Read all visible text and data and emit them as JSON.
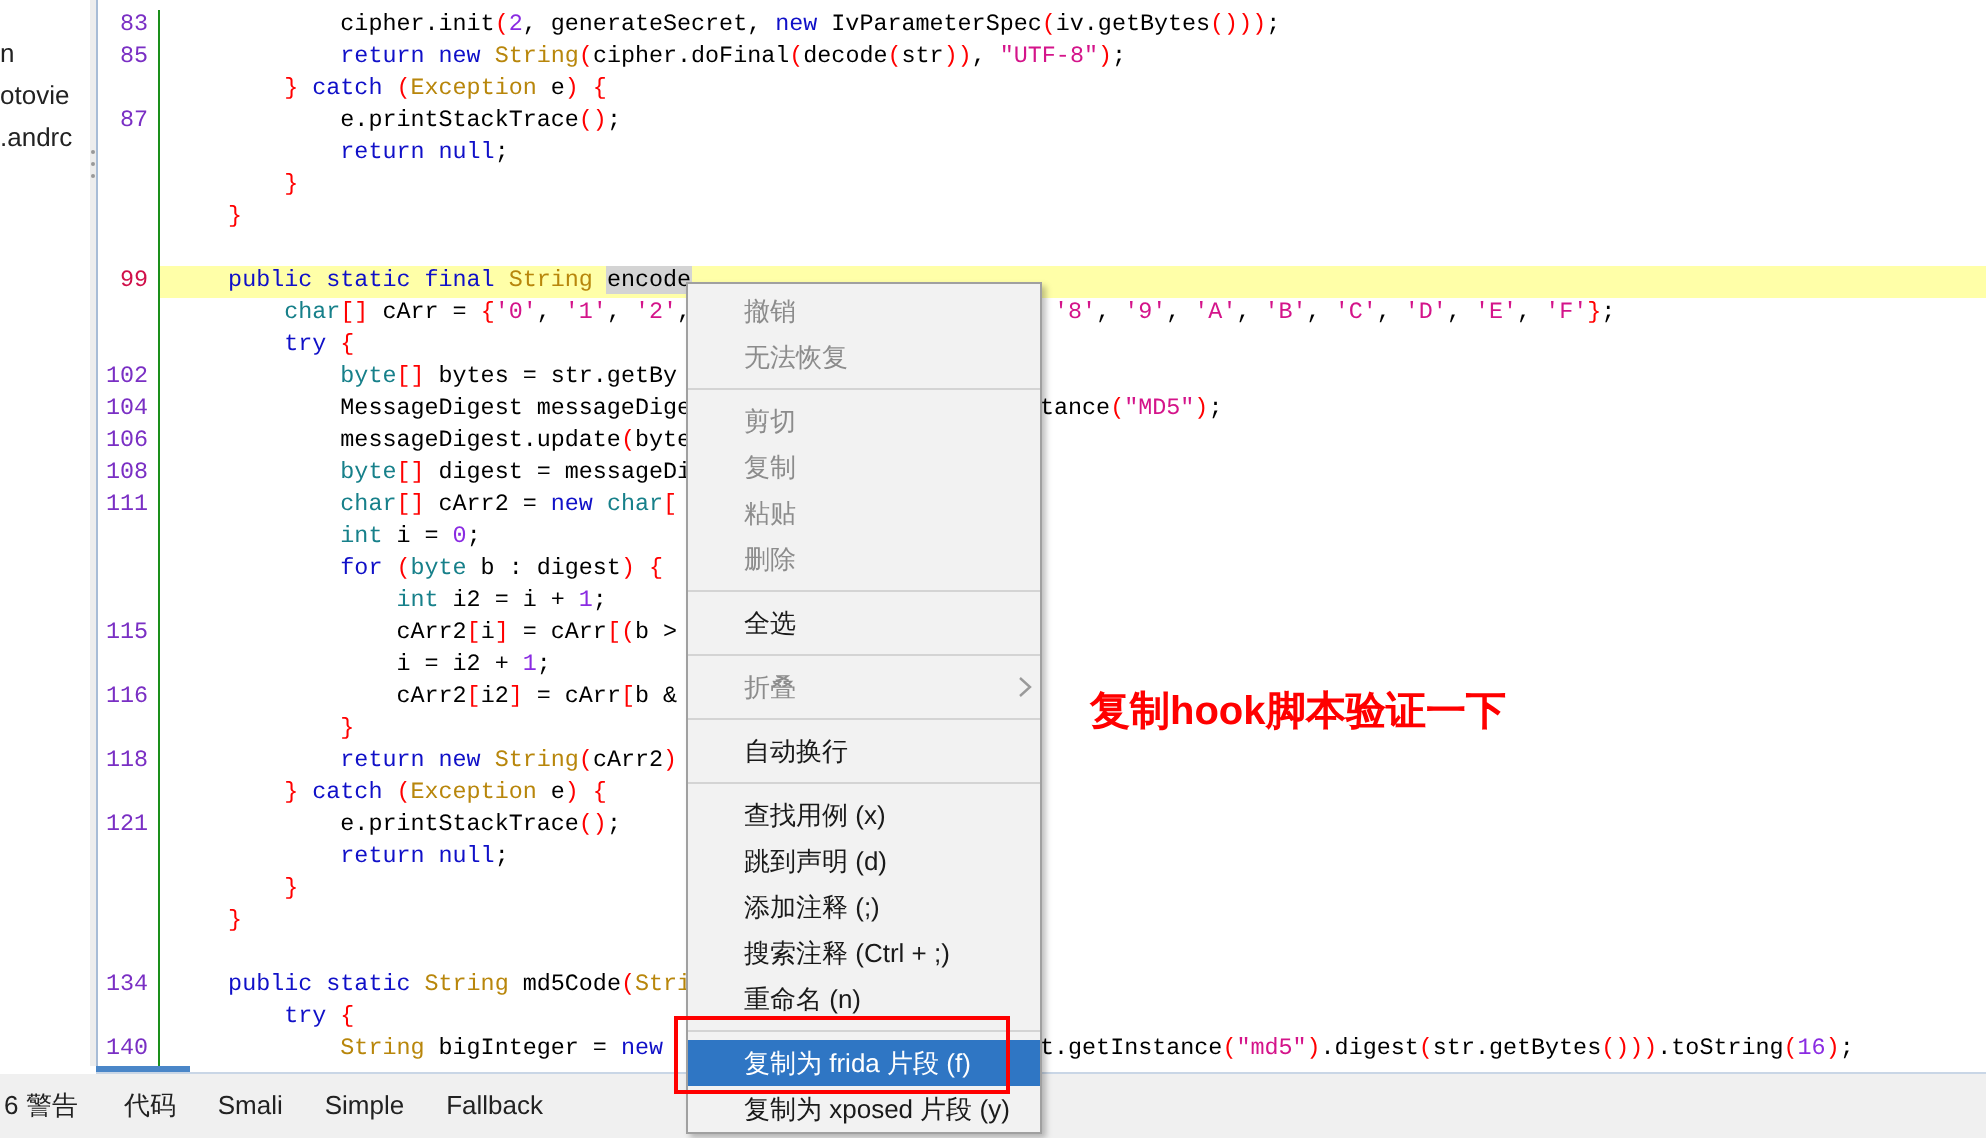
{
  "tree": {
    "items": [
      "n",
      "otovie",
      ".andrc"
    ]
  },
  "editor": {
    "lines": [
      {
        "number": "83",
        "selected": false,
        "tokens": [
          {
            "kind": "plain",
            "text": "            cipher.init"
          },
          {
            "kind": "br",
            "text": "("
          },
          {
            "kind": "num",
            "text": "2"
          },
          {
            "kind": "plain",
            "text": ", generateSecret, "
          },
          {
            "kind": "kw",
            "text": "new"
          },
          {
            "kind": "plain",
            "text": " IvParameterSpec"
          },
          {
            "kind": "br",
            "text": "("
          },
          {
            "kind": "plain",
            "text": "iv.getBytes"
          },
          {
            "kind": "br",
            "text": "()))"
          },
          {
            "kind": "plain",
            "text": ";"
          }
        ]
      },
      {
        "number": "85",
        "selected": false,
        "tokens": [
          {
            "kind": "kw",
            "text": "            return new "
          },
          {
            "kind": "type",
            "text": "String"
          },
          {
            "kind": "br",
            "text": "("
          },
          {
            "kind": "plain",
            "text": "cipher.doFinal"
          },
          {
            "kind": "br",
            "text": "("
          },
          {
            "kind": "plain",
            "text": "decode"
          },
          {
            "kind": "br",
            "text": "("
          },
          {
            "kind": "plain",
            "text": "str"
          },
          {
            "kind": "br",
            "text": "))"
          },
          {
            "kind": "plain",
            "text": ", "
          },
          {
            "kind": "str",
            "text": "\"UTF-8\""
          },
          {
            "kind": "br",
            "text": ")"
          },
          {
            "kind": "plain",
            "text": ";"
          }
        ]
      },
      {
        "selected": false,
        "tokens": [
          {
            "kind": "br",
            "text": "        } "
          },
          {
            "kind": "kw",
            "text": "catch "
          },
          {
            "kind": "br",
            "text": "("
          },
          {
            "kind": "type",
            "text": "Exception"
          },
          {
            "kind": "plain",
            "text": " e"
          },
          {
            "kind": "br",
            "text": ") {"
          }
        ]
      },
      {
        "number": "87",
        "selected": false,
        "tokens": [
          {
            "kind": "plain",
            "text": "            e.printStackTrace"
          },
          {
            "kind": "br",
            "text": "()"
          },
          {
            "kind": "plain",
            "text": ";"
          }
        ]
      },
      {
        "selected": false,
        "tokens": [
          {
            "kind": "kw",
            "text": "            return null"
          },
          {
            "kind": "plain",
            "text": ";"
          }
        ]
      },
      {
        "selected": false,
        "tokens": [
          {
            "kind": "br",
            "text": "        }"
          }
        ]
      },
      {
        "selected": false,
        "tokens": [
          {
            "kind": "br",
            "text": "    }"
          }
        ]
      },
      {
        "selected": false
      },
      {
        "number": "99",
        "selected": true,
        "tokens": [
          {
            "kind": "kw",
            "text": "    public static final "
          },
          {
            "kind": "type",
            "text": "String "
          },
          {
            "kind": "match",
            "text": "encode"
          }
        ]
      },
      {
        "selected": false,
        "tokens": [
          {
            "kind": "prim",
            "text": "        char"
          },
          {
            "kind": "br",
            "text": "[]"
          },
          {
            "kind": "plain",
            "text": " cArr = "
          },
          {
            "kind": "br",
            "text": "{"
          },
          {
            "kind": "str",
            "text": "'0'"
          },
          {
            "kind": "plain",
            "text": ", "
          },
          {
            "kind": "str",
            "text": "'1'"
          },
          {
            "kind": "plain",
            "text": ", "
          },
          {
            "kind": "str",
            "text": "'2'"
          },
          {
            "kind": "plain",
            "text": ","
          }
        ],
        "right": [
          {
            "kind": "str",
            "text": " '8'"
          },
          {
            "kind": "plain",
            "text": ", "
          },
          {
            "kind": "str",
            "text": "'9'"
          },
          {
            "kind": "plain",
            "text": ", "
          },
          {
            "kind": "str",
            "text": "'A'"
          },
          {
            "kind": "plain",
            "text": ", "
          },
          {
            "kind": "str",
            "text": "'B'"
          },
          {
            "kind": "plain",
            "text": ", "
          },
          {
            "kind": "str",
            "text": "'C'"
          },
          {
            "kind": "plain",
            "text": ", "
          },
          {
            "kind": "str",
            "text": "'D'"
          },
          {
            "kind": "plain",
            "text": ", "
          },
          {
            "kind": "str",
            "text": "'E'"
          },
          {
            "kind": "plain",
            "text": ", "
          },
          {
            "kind": "str",
            "text": "'F'"
          },
          {
            "kind": "br",
            "text": "}"
          },
          {
            "kind": "plain",
            "text": ";"
          }
        ]
      },
      {
        "selected": false,
        "tokens": [
          {
            "kind": "kw",
            "text": "        try "
          },
          {
            "kind": "br",
            "text": "{"
          }
        ]
      },
      {
        "number": "102",
        "selected": false,
        "tokens": [
          {
            "kind": "prim",
            "text": "            byte"
          },
          {
            "kind": "br",
            "text": "[]"
          },
          {
            "kind": "plain",
            "text": " bytes = str.getBy"
          }
        ]
      },
      {
        "number": "104",
        "selected": false,
        "tokens": [
          {
            "kind": "plain",
            "text": "            MessageDigest messageDige"
          }
        ],
        "right": [
          {
            "kind": "plain",
            "text": "tance"
          },
          {
            "kind": "br",
            "text": "("
          },
          {
            "kind": "str",
            "text": "\"MD5\""
          },
          {
            "kind": "br",
            "text": ")"
          },
          {
            "kind": "plain",
            "text": ";"
          }
        ]
      },
      {
        "number": "106",
        "selected": false,
        "tokens": [
          {
            "kind": "plain",
            "text": "            messageDigest.update"
          },
          {
            "kind": "br",
            "text": "("
          },
          {
            "kind": "plain",
            "text": "byte"
          }
        ]
      },
      {
        "number": "108",
        "selected": false,
        "tokens": [
          {
            "kind": "prim",
            "text": "            byte"
          },
          {
            "kind": "br",
            "text": "[]"
          },
          {
            "kind": "plain",
            "text": " digest = messageDi"
          }
        ]
      },
      {
        "number": "111",
        "selected": false,
        "tokens": [
          {
            "kind": "prim",
            "text": "            char"
          },
          {
            "kind": "br",
            "text": "[]"
          },
          {
            "kind": "plain",
            "text": " cArr2 = "
          },
          {
            "kind": "kw",
            "text": "new "
          },
          {
            "kind": "prim",
            "text": "char"
          },
          {
            "kind": "br",
            "text": "["
          }
        ]
      },
      {
        "selected": false,
        "tokens": [
          {
            "kind": "prim",
            "text": "            int"
          },
          {
            "kind": "plain",
            "text": " i = "
          },
          {
            "kind": "num",
            "text": "0"
          },
          {
            "kind": "plain",
            "text": ";"
          }
        ]
      },
      {
        "selected": false,
        "tokens": [
          {
            "kind": "kw",
            "text": "            for "
          },
          {
            "kind": "br",
            "text": "("
          },
          {
            "kind": "prim",
            "text": "byte"
          },
          {
            "kind": "plain",
            "text": " b : digest"
          },
          {
            "kind": "br",
            "text": ") {"
          }
        ]
      },
      {
        "selected": false,
        "tokens": [
          {
            "kind": "prim",
            "text": "                int"
          },
          {
            "kind": "plain",
            "text": " i2 = i + "
          },
          {
            "kind": "num",
            "text": "1"
          },
          {
            "kind": "plain",
            "text": ";"
          }
        ]
      },
      {
        "number": "115",
        "selected": false,
        "tokens": [
          {
            "kind": "plain",
            "text": "                cArr2"
          },
          {
            "kind": "br",
            "text": "["
          },
          {
            "kind": "plain",
            "text": "i"
          },
          {
            "kind": "br",
            "text": "]"
          },
          {
            "kind": "plain",
            "text": " = cArr"
          },
          {
            "kind": "br",
            "text": "[("
          },
          {
            "kind": "plain",
            "text": "b >"
          }
        ]
      },
      {
        "selected": false,
        "tokens": [
          {
            "kind": "plain",
            "text": "                i = i2 + "
          },
          {
            "kind": "num",
            "text": "1"
          },
          {
            "kind": "plain",
            "text": ";"
          }
        ]
      },
      {
        "number": "116",
        "selected": false,
        "tokens": [
          {
            "kind": "plain",
            "text": "                cArr2"
          },
          {
            "kind": "br",
            "text": "["
          },
          {
            "kind": "plain",
            "text": "i2"
          },
          {
            "kind": "br",
            "text": "]"
          },
          {
            "kind": "plain",
            "text": " = cArr"
          },
          {
            "kind": "br",
            "text": "["
          },
          {
            "kind": "plain",
            "text": "b &"
          }
        ]
      },
      {
        "selected": false,
        "tokens": [
          {
            "kind": "br",
            "text": "            }"
          }
        ]
      },
      {
        "number": "118",
        "selected": false,
        "tokens": [
          {
            "kind": "kw",
            "text": "            return new "
          },
          {
            "kind": "type",
            "text": "String"
          },
          {
            "kind": "br",
            "text": "("
          },
          {
            "kind": "plain",
            "text": "cArr2"
          },
          {
            "kind": "br",
            "text": ")"
          }
        ]
      },
      {
        "selected": false,
        "tokens": [
          {
            "kind": "br",
            "text": "        } "
          },
          {
            "kind": "kw",
            "text": "catch "
          },
          {
            "kind": "br",
            "text": "("
          },
          {
            "kind": "type",
            "text": "Exception"
          },
          {
            "kind": "plain",
            "text": " e"
          },
          {
            "kind": "br",
            "text": ") {"
          }
        ]
      },
      {
        "number": "121",
        "selected": false,
        "tokens": [
          {
            "kind": "plain",
            "text": "            e.printStackTrace"
          },
          {
            "kind": "br",
            "text": "()"
          },
          {
            "kind": "plain",
            "text": ";"
          }
        ]
      },
      {
        "selected": false,
        "tokens": [
          {
            "kind": "kw",
            "text": "            return null"
          },
          {
            "kind": "plain",
            "text": ";"
          }
        ]
      },
      {
        "selected": false,
        "tokens": [
          {
            "kind": "br",
            "text": "        }"
          }
        ]
      },
      {
        "selected": false,
        "tokens": [
          {
            "kind": "br",
            "text": "    }"
          }
        ]
      },
      {
        "selected": false
      },
      {
        "number": "134",
        "selected": false,
        "tokens": [
          {
            "kind": "kw",
            "text": "    public static "
          },
          {
            "kind": "type",
            "text": "String"
          },
          {
            "kind": "plain",
            "text": " md5Code"
          },
          {
            "kind": "br",
            "text": "("
          },
          {
            "kind": "type",
            "text": "Stri"
          }
        ]
      },
      {
        "selected": false,
        "tokens": [
          {
            "kind": "kw",
            "text": "        try "
          },
          {
            "kind": "br",
            "text": "{"
          }
        ]
      },
      {
        "number": "140",
        "selected": false,
        "tokens": [
          {
            "kind": "type",
            "text": "            String"
          },
          {
            "kind": "plain",
            "text": " bigInteger = "
          },
          {
            "kind": "kw",
            "text": "new"
          }
        ],
        "right": [
          {
            "kind": "plain",
            "text": "t.getInstance"
          },
          {
            "kind": "br",
            "text": "("
          },
          {
            "kind": "str",
            "text": "\"md5\""
          },
          {
            "kind": "br",
            "text": ")"
          },
          {
            "kind": "plain",
            "text": ".digest"
          },
          {
            "kind": "br",
            "text": "("
          },
          {
            "kind": "plain",
            "text": "str.getBytes"
          },
          {
            "kind": "br",
            "text": "()))"
          },
          {
            "kind": "plain",
            "text": ".toString"
          },
          {
            "kind": "br",
            "text": "("
          },
          {
            "kind": "num",
            "text": "16"
          },
          {
            "kind": "br",
            "text": ")"
          },
          {
            "kind": "plain",
            "text": ";"
          }
        ]
      }
    ]
  },
  "bottom_tabs": [
    "6 警告",
    "代码",
    "Smali",
    "Simple",
    "Fallback"
  ],
  "context_menu": {
    "items": [
      {
        "kind": "item",
        "label": "撤销",
        "disabled": true,
        "selected": false
      },
      {
        "kind": "item",
        "label": "无法恢复",
        "disabled": true,
        "selected": false
      },
      {
        "kind": "separator"
      },
      {
        "kind": "item",
        "label": "剪切",
        "disabled": true,
        "selected": false
      },
      {
        "kind": "item",
        "label": "复制",
        "disabled": true,
        "selected": false
      },
      {
        "kind": "item",
        "label": "粘贴",
        "disabled": true,
        "selected": false
      },
      {
        "kind": "item",
        "label": "删除",
        "disabled": true,
        "selected": false
      },
      {
        "kind": "separator"
      },
      {
        "kind": "item",
        "label": "全选",
        "disabled": false,
        "selected": false
      },
      {
        "kind": "separator"
      },
      {
        "kind": "item",
        "label": "折叠",
        "disabled": true,
        "selected": false,
        "submenu": true
      },
      {
        "kind": "separator"
      },
      {
        "kind": "item",
        "label": "自动换行",
        "disabled": false,
        "selected": false
      },
      {
        "kind": "separator"
      },
      {
        "kind": "item",
        "label": "查找用例 (x)",
        "disabled": false,
        "selected": false
      },
      {
        "kind": "item",
        "label": "跳到声明 (d)",
        "disabled": false,
        "selected": false
      },
      {
        "kind": "item",
        "label": "添加注释 (;)",
        "disabled": false,
        "selected": false
      },
      {
        "kind": "item",
        "label": "搜索注释 (Ctrl + ;)",
        "disabled": false,
        "selected": false
      },
      {
        "kind": "item",
        "label": "重命名 (n)",
        "disabled": false,
        "selected": false
      },
      {
        "kind": "separator"
      },
      {
        "kind": "item",
        "label": "复制为 frida 片段 (f)",
        "disabled": false,
        "selected": true
      },
      {
        "kind": "item",
        "label": "复制为 xposed 片段 (y)",
        "disabled": false,
        "selected": false
      }
    ]
  },
  "annotation": {
    "text": "复制hook脚本验证一下"
  }
}
